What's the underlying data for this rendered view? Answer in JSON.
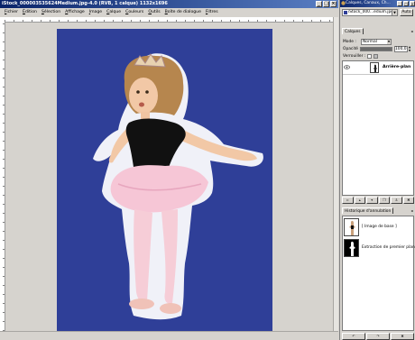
{
  "main_window": {
    "title": "iStock_000003535624Medium.jpg-4.0 (RVB, 1 calque) 1132x1696",
    "menu": [
      "Fichier",
      "Édition",
      "Sélection",
      "Affichage",
      "Image",
      "Calque",
      "Couleurs",
      "Outils",
      "Boîte de dialogue",
      "Filtres"
    ],
    "window_buttons": {
      "minimize": "_",
      "maximize": "□",
      "close": "×"
    }
  },
  "dock": {
    "title": "Calques, Canaux, Ch...",
    "image_selector": "iStock_000...edium.jpg-4",
    "auto_button": "Auto",
    "layers_panel": {
      "tab": "Calques",
      "mode_label": "Mode :",
      "mode_value": "Normal",
      "opacity_label": "Opacité :",
      "opacity_value": "100,0",
      "opacity_fraction": 1.0,
      "lock_label": "Verrouiller :",
      "layers": [
        {
          "name": "Arrière-plan",
          "visible": true
        }
      ]
    },
    "history_panel": {
      "tab": "Historique d'annulation",
      "entries": [
        {
          "label": "[ Image de base ]"
        },
        {
          "label": "Extraction de premier plan"
        }
      ]
    }
  },
  "colors": {
    "photo_background": "#2f3f98",
    "titlebar": "#0a246a",
    "chrome": "#d6d3ce"
  }
}
